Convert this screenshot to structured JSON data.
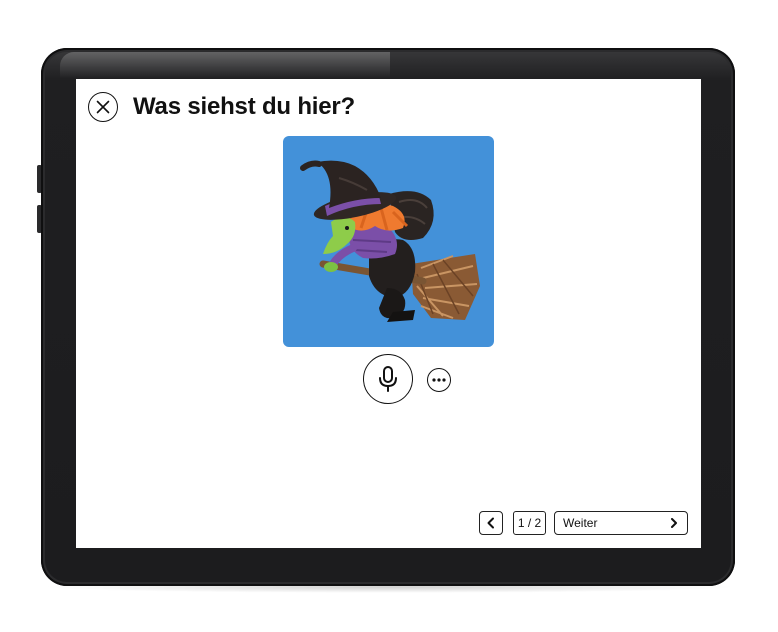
{
  "header": {
    "title": "Was siehst du hier?"
  },
  "picture": {
    "background_color": "#4391d9",
    "subject": "witch on a broomstick"
  },
  "controls": {
    "close_icon": "close-icon",
    "mic_icon": "microphone-icon",
    "more_icon": "more-options-icon"
  },
  "pager": {
    "current": "1 / 2",
    "next_label": "Weiter"
  }
}
